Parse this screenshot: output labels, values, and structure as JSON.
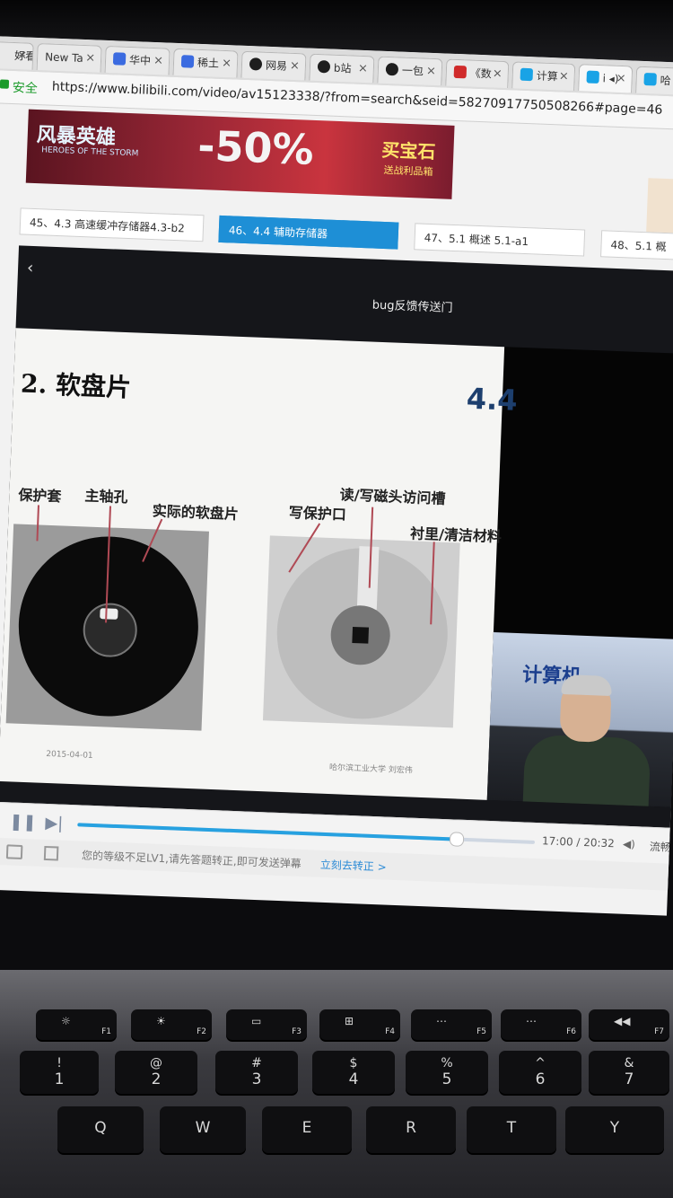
{
  "browser": {
    "tabs": [
      {
        "label": "好看",
        "color": "#e6e6e6"
      },
      {
        "label": "New Ta",
        "color": "#e6e6e6"
      },
      {
        "label": "华中",
        "color": "#3b6be0"
      },
      {
        "label": "稀土",
        "color": "#3b6be0"
      },
      {
        "label": "网易",
        "color": "#1e1e1e"
      },
      {
        "label": "b站",
        "color": "#1e1e1e"
      },
      {
        "label": "一包",
        "color": "#1e1e1e"
      },
      {
        "label": "《数",
        "color": "#d02a2a"
      },
      {
        "label": "计算",
        "color": "#19a3e6"
      },
      {
        "label": "i ◂)",
        "color": "#19a3e6"
      },
      {
        "label": "哈",
        "color": "#19a3e6"
      }
    ],
    "secure_label": "安全",
    "url": "https://www.bilibili.com/video/av15123338/?from=search&seid=5827091775050826​6#page=46"
  },
  "banner": {
    "logo": "风暴英雄",
    "logo_sub": "HEROES OF THE STORM",
    "deal": "-50%",
    "cta": "买宝石",
    "cta_sub": "送战利品箱"
  },
  "episodes": [
    {
      "label": "45、4.3 高速缓冲存储器4.3-b2",
      "active": false
    },
    {
      "label": "46、4.4 辅助存储器",
      "active": true
    },
    {
      "label": "47、5.1 概述 5.1-a1",
      "active": false
    },
    {
      "label": "48、5.1 概",
      "active": false
    }
  ],
  "player": {
    "message": "bug反馈传送门",
    "progress": 0.8281,
    "time": "17:00 / 20:32",
    "quality": "流畅",
    "danmaku_tip": "您的等级不足LV1,请先答题转正,即可发送弹幕",
    "danmaku_link": "立刻去转正 >"
  },
  "slide": {
    "title": "2. 软盘片",
    "section": "4.4",
    "left_labels": [
      "保护套",
      "主轴孔",
      "实际的软盘片"
    ],
    "right_labels": [
      "读/写磁头访问槽",
      "写保护口",
      "衬里/清洁材料"
    ],
    "date": "2015-04-01",
    "institution": "哈尔滨工业大学  刘宏伟",
    "speaker_backdrop": "计算机"
  },
  "keyboard": {
    "fkeys": [
      {
        "label": "F1",
        "icon": "☼"
      },
      {
        "label": "F2",
        "icon": "☀"
      },
      {
        "label": "F3",
        "icon": "▭"
      },
      {
        "label": "F4",
        "icon": "⊞"
      },
      {
        "label": "F5",
        "icon": "⋯"
      },
      {
        "label": "F6",
        "icon": "⋯"
      },
      {
        "label": "F7",
        "icon": "◀◀"
      }
    ],
    "numkeys": [
      {
        "top": "!",
        "bot": "1"
      },
      {
        "top": "@",
        "bot": "2"
      },
      {
        "top": "#",
        "bot": "3"
      },
      {
        "top": "$",
        "bot": "4"
      },
      {
        "top": "%",
        "bot": "5"
      },
      {
        "top": "^",
        "bot": "6"
      },
      {
        "top": "&",
        "bot": "7"
      }
    ],
    "letters": [
      "Q",
      "W",
      "E",
      "R",
      "T",
      "Y"
    ]
  }
}
